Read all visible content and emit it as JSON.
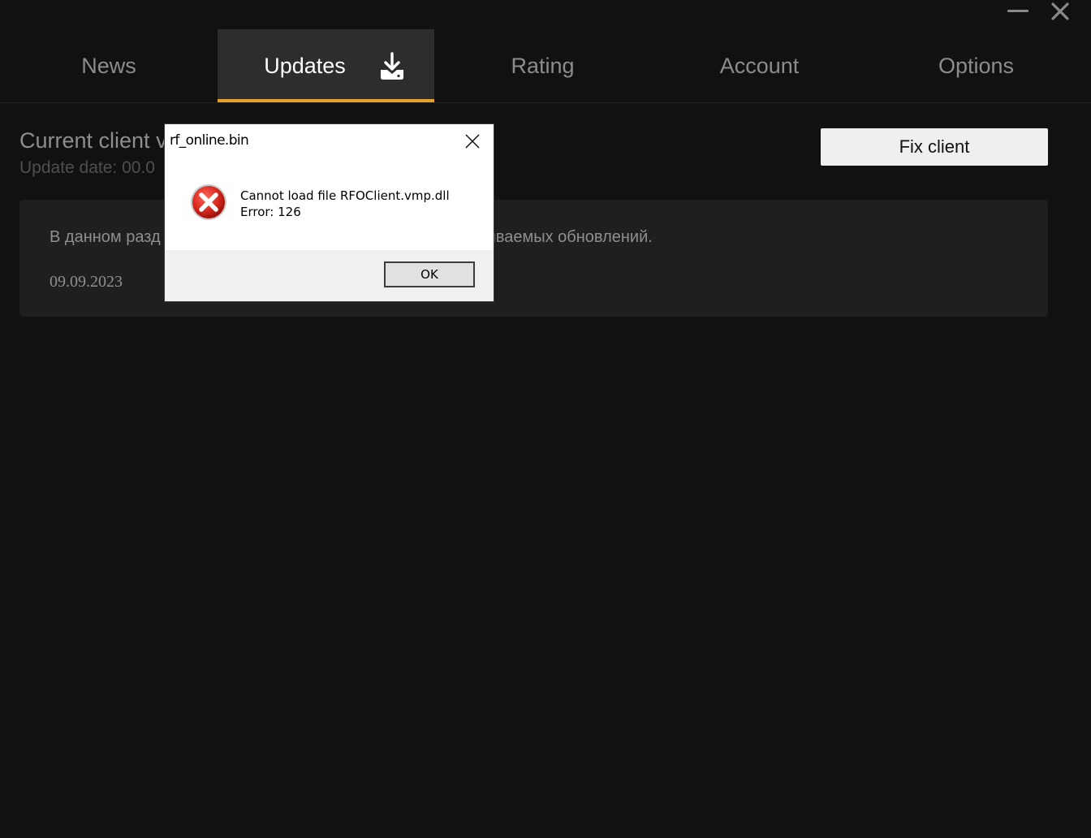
{
  "window": {
    "minimize_icon": "minimize-icon",
    "close_icon": "close-icon"
  },
  "tabs": [
    {
      "label": "News"
    },
    {
      "label": "Updates",
      "active": true,
      "icon": "download-icon"
    },
    {
      "label": "Rating"
    },
    {
      "label": "Account"
    },
    {
      "label": "Options"
    }
  ],
  "client": {
    "title": "Current client v",
    "update_date": "Update date: 00.0",
    "fix_label": "Fix client"
  },
  "card": {
    "text_left": "В данном разд",
    "text_right": "ливаемых обновлений.",
    "date": "09.09.2023"
  },
  "dialog": {
    "title": "rf_online.bin",
    "message_line1": "Cannot load file RFOClient.vmp.dll",
    "message_line2": "Error: 126",
    "ok_label": "OK",
    "icon": "error-icon"
  },
  "colors": {
    "background": "#111111",
    "tab_active_bg": "#2d2d2d",
    "accent": "#e3a22e",
    "card_bg": "#1f1f1f",
    "button_bg": "#efefef"
  }
}
